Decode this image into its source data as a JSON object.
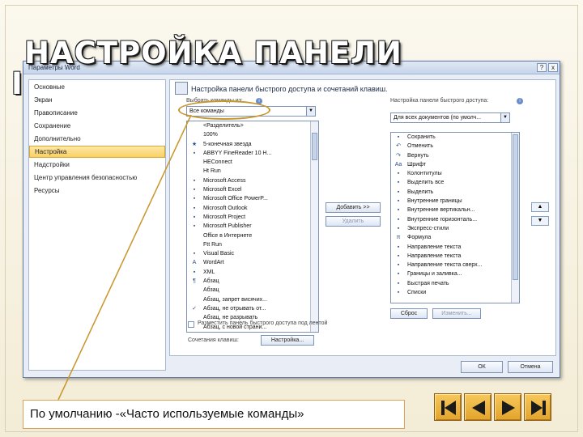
{
  "slide": {
    "title_line1": "НАСТРОЙКА ПАНЕЛИ",
    "title_line2": "I"
  },
  "dialog": {
    "title": "Параметры Word",
    "controls": {
      "minimize": "?",
      "close": "x"
    },
    "nav_items": [
      "Основные",
      "Экран",
      "Правописание",
      "Сохранение",
      "Дополнительно",
      "Настройка",
      "Надстройки",
      "Центр управления безопасностью",
      "Ресурсы"
    ],
    "selected_nav_index": 5,
    "content": {
      "heading": "Настройка панели быстрого доступа и сочетаний клавиш.",
      "choose_label": "Выбрать команды из:",
      "choose_value": "Все команды",
      "customize_label": "Настройка панели быстрого доступа:",
      "customize_value": "Для всех документов (по умолч...",
      "left_list": [
        {
          "label": "<Разделитель>",
          "icon": ""
        },
        {
          "label": "100%",
          "icon": ""
        },
        {
          "label": "5-конечная звезда",
          "icon": "★"
        },
        {
          "label": "ABBYY FineReader 10 Н...",
          "icon": "▪",
          "sub": "▾"
        },
        {
          "label": "HEConnect",
          "icon": ""
        },
        {
          "label": "Ht Run",
          "icon": ""
        },
        {
          "label": "Microsoft Access",
          "icon": "▪"
        },
        {
          "label": "Microsoft Excel",
          "icon": "▪"
        },
        {
          "label": "Microsoft Office PowerP...",
          "icon": "▪"
        },
        {
          "label": "Microsoft Outlook",
          "icon": "▪"
        },
        {
          "label": "Microsoft Project",
          "icon": "▪"
        },
        {
          "label": "Microsoft Publisher",
          "icon": "▪"
        },
        {
          "label": "Office в Интернете",
          "icon": ""
        },
        {
          "label": "Ftt Run",
          "icon": ""
        },
        {
          "label": "Visual Basic",
          "icon": "▪"
        },
        {
          "label": "WordArt",
          "icon": "A",
          "sub": "▸"
        },
        {
          "label": "XML",
          "icon": "▪"
        },
        {
          "label": "Абзац",
          "icon": "¶",
          "sub": "▸"
        },
        {
          "label": "Абзац",
          "icon": ""
        },
        {
          "label": "Абзац, запрет висячих...",
          "icon": ""
        },
        {
          "label": "Абзац, не отрывать от...",
          "icon": "✓"
        },
        {
          "label": "Абзац, не разрывать",
          "icon": ""
        },
        {
          "label": "Абзац, с новой страни...",
          "icon": ""
        }
      ],
      "right_list": [
        {
          "label": "Сохранить",
          "icon": "▪"
        },
        {
          "label": "Отменить",
          "icon": "↶",
          "sub": "▸"
        },
        {
          "label": "Вернуть",
          "icon": "↷"
        },
        {
          "label": "Шрифт",
          "icon": "Aa",
          "sub": "▸"
        },
        {
          "label": "Колонтитулы",
          "icon": "▪",
          "sub": "▾"
        },
        {
          "label": "Выделить все",
          "icon": "▪"
        },
        {
          "label": "Выделить",
          "icon": "▪",
          "sub": "▸"
        },
        {
          "label": "Внутренние границы",
          "icon": "▪"
        },
        {
          "label": "Внутренние вертикальн...",
          "icon": "▪"
        },
        {
          "label": "Внутренние горизонталь...",
          "icon": "▪"
        },
        {
          "label": "Экспресс-стили",
          "icon": "▪",
          "sub": "▸"
        },
        {
          "label": "Формула",
          "icon": "π",
          "sub": "▸"
        },
        {
          "label": "Направление текста",
          "icon": "▪"
        },
        {
          "label": "Направление текста",
          "icon": "▪"
        },
        {
          "label": "Направление текста сверх...",
          "icon": "▪"
        },
        {
          "label": "Границы и заливка...",
          "icon": "▪"
        },
        {
          "label": "Быстрая печать",
          "icon": "▪"
        },
        {
          "label": "Списки",
          "icon": "▪"
        }
      ],
      "add_button": "Добавить >>",
      "remove_button": "Удалить",
      "reset_button": "Сброс",
      "modify_button": "Изменить...",
      "show_below_label": "Разместить панель быстрого доступа под лентой",
      "shortcuts_label": "Сочетания клавиш:",
      "shortcuts_button": "Настройка..."
    },
    "ok_button": "ОК",
    "cancel_button": "Отмена"
  },
  "caption": {
    "text": "По умолчанию -«Часто используемые команды»"
  },
  "nav_buttons": {
    "first": "first-slide-icon",
    "prev": "previous-slide-icon",
    "next": "next-slide-icon",
    "last": "last-slide-icon"
  },
  "colors": {
    "accent": "#e2a42c",
    "highlight_ring": "#c8962a",
    "selected_nav": "#f8cf63"
  }
}
